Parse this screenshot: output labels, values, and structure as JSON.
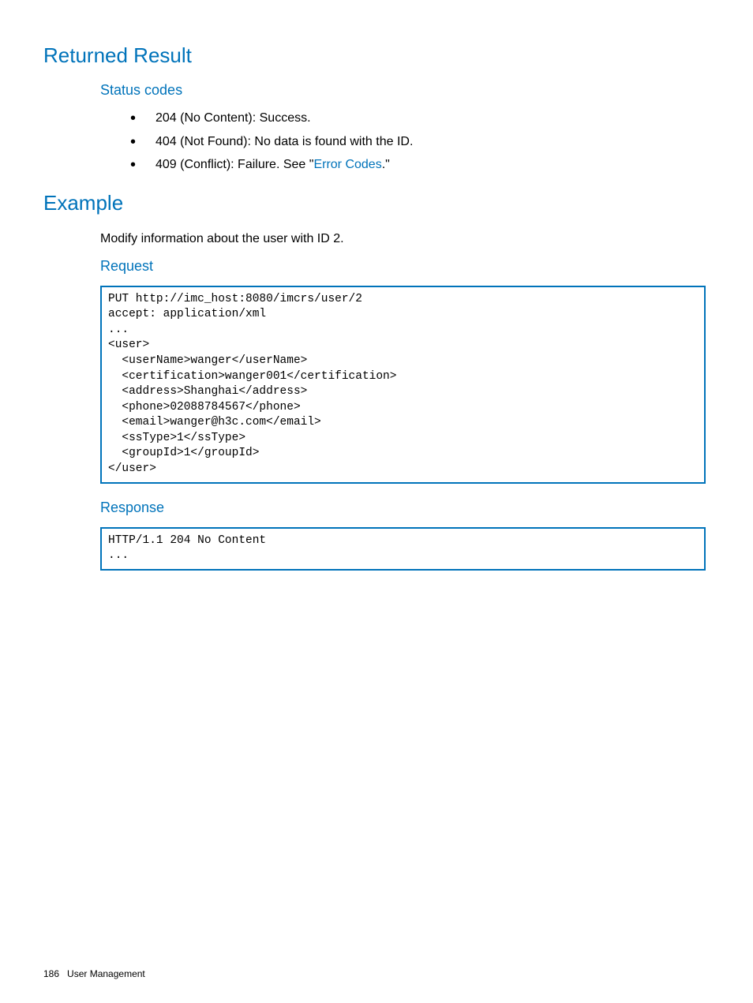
{
  "sections": {
    "returned_result": {
      "title": "Returned Result",
      "status_codes": {
        "title": "Status codes",
        "items": [
          "204 (No Content): Success.",
          "404 (Not Found): No data is found with the ID."
        ],
        "item3_prefix": "409 (Conflict): Failure. See \"",
        "item3_link": "Error Codes",
        "item3_suffix": ".\""
      }
    },
    "example": {
      "title": "Example",
      "intro": "Modify information about the user with ID 2.",
      "request": {
        "title": "Request",
        "code": "PUT http://imc_host:8080/imcrs/user/2\naccept: application/xml\n...\n<user>\n  <userName>wanger</userName>\n  <certification>wanger001</certification>\n  <address>Shanghai</address>\n  <phone>02088784567</phone>\n  <email>wanger@h3c.com</email>\n  <ssType>1</ssType>\n  <groupId>1</groupId>\n</user>"
      },
      "response": {
        "title": "Response",
        "code": "HTTP/1.1 204 No Content\n..."
      }
    }
  },
  "footer": {
    "page_number": "186",
    "section_name": "User Management"
  }
}
